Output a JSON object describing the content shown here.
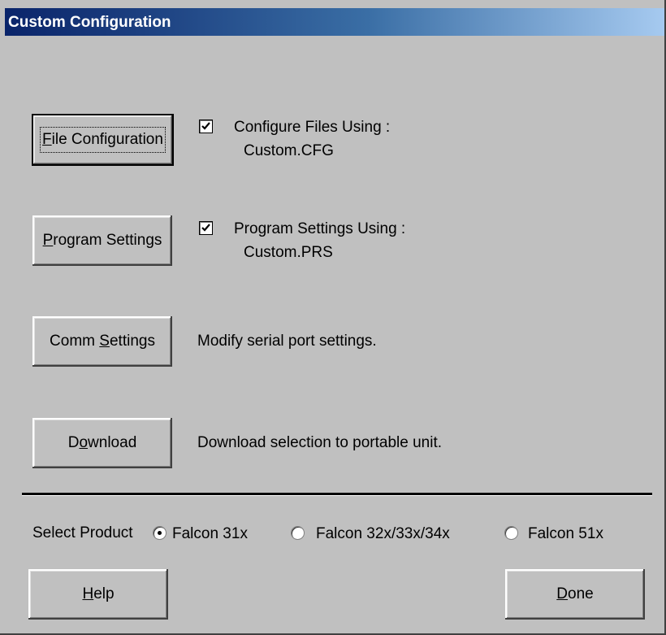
{
  "window": {
    "title": "Custom Configuration"
  },
  "buttons": {
    "file_configuration": {
      "pre": "",
      "key": "F",
      "post": "ile Configuration"
    },
    "program_settings": {
      "pre": "",
      "key": "P",
      "post": "rogram Settings"
    },
    "comm_settings": {
      "pre": "Comm ",
      "key": "S",
      "post": "ettings"
    },
    "download": {
      "pre": "D",
      "key": "o",
      "post": "wnload"
    },
    "help": {
      "pre": "",
      "key": "H",
      "post": "elp"
    },
    "done": {
      "pre": "",
      "key": "D",
      "post": "one"
    }
  },
  "options": {
    "configure_files": {
      "checked": true,
      "label": "Configure Files Using :",
      "file": "Custom.CFG"
    },
    "program_settings": {
      "checked": true,
      "label": "Program Settings Using :",
      "file": "Custom.PRS"
    }
  },
  "descriptions": {
    "comm_settings": "Modify serial port settings.",
    "download": "Download selection to portable unit."
  },
  "product": {
    "label": "Select Product",
    "options": [
      {
        "label": "Falcon 31x",
        "selected": true
      },
      {
        "label": "Falcon 32x/33x/34x",
        "selected": false
      },
      {
        "label": "Falcon 51x",
        "selected": false
      }
    ]
  }
}
